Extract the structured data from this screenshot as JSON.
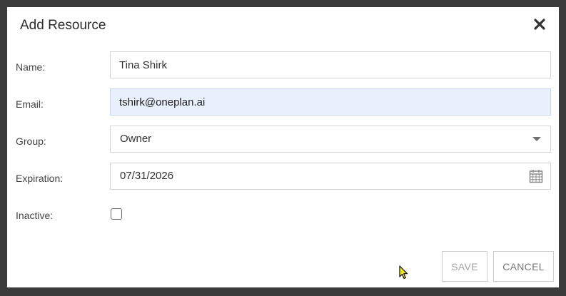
{
  "dialog": {
    "title": "Add Resource",
    "close_icon": "close-icon"
  },
  "form": {
    "name": {
      "label": "Name:",
      "value": "Tina Shirk"
    },
    "email": {
      "label": "Email:",
      "value": "tshirk@oneplan.ai"
    },
    "group": {
      "label": "Group:",
      "value": "Owner",
      "icon": "chevron-down-icon"
    },
    "expiration": {
      "label": "Expiration:",
      "value": "07/31/2026",
      "icon": "calendar-icon"
    },
    "inactive": {
      "label": "Inactive:",
      "checked": false
    }
  },
  "buttons": {
    "save_label": "SAVE",
    "cancel_label": "CANCEL"
  },
  "colors": {
    "focused_field_bg": "#e8f0fe",
    "backdrop": "#3b3b3b"
  }
}
